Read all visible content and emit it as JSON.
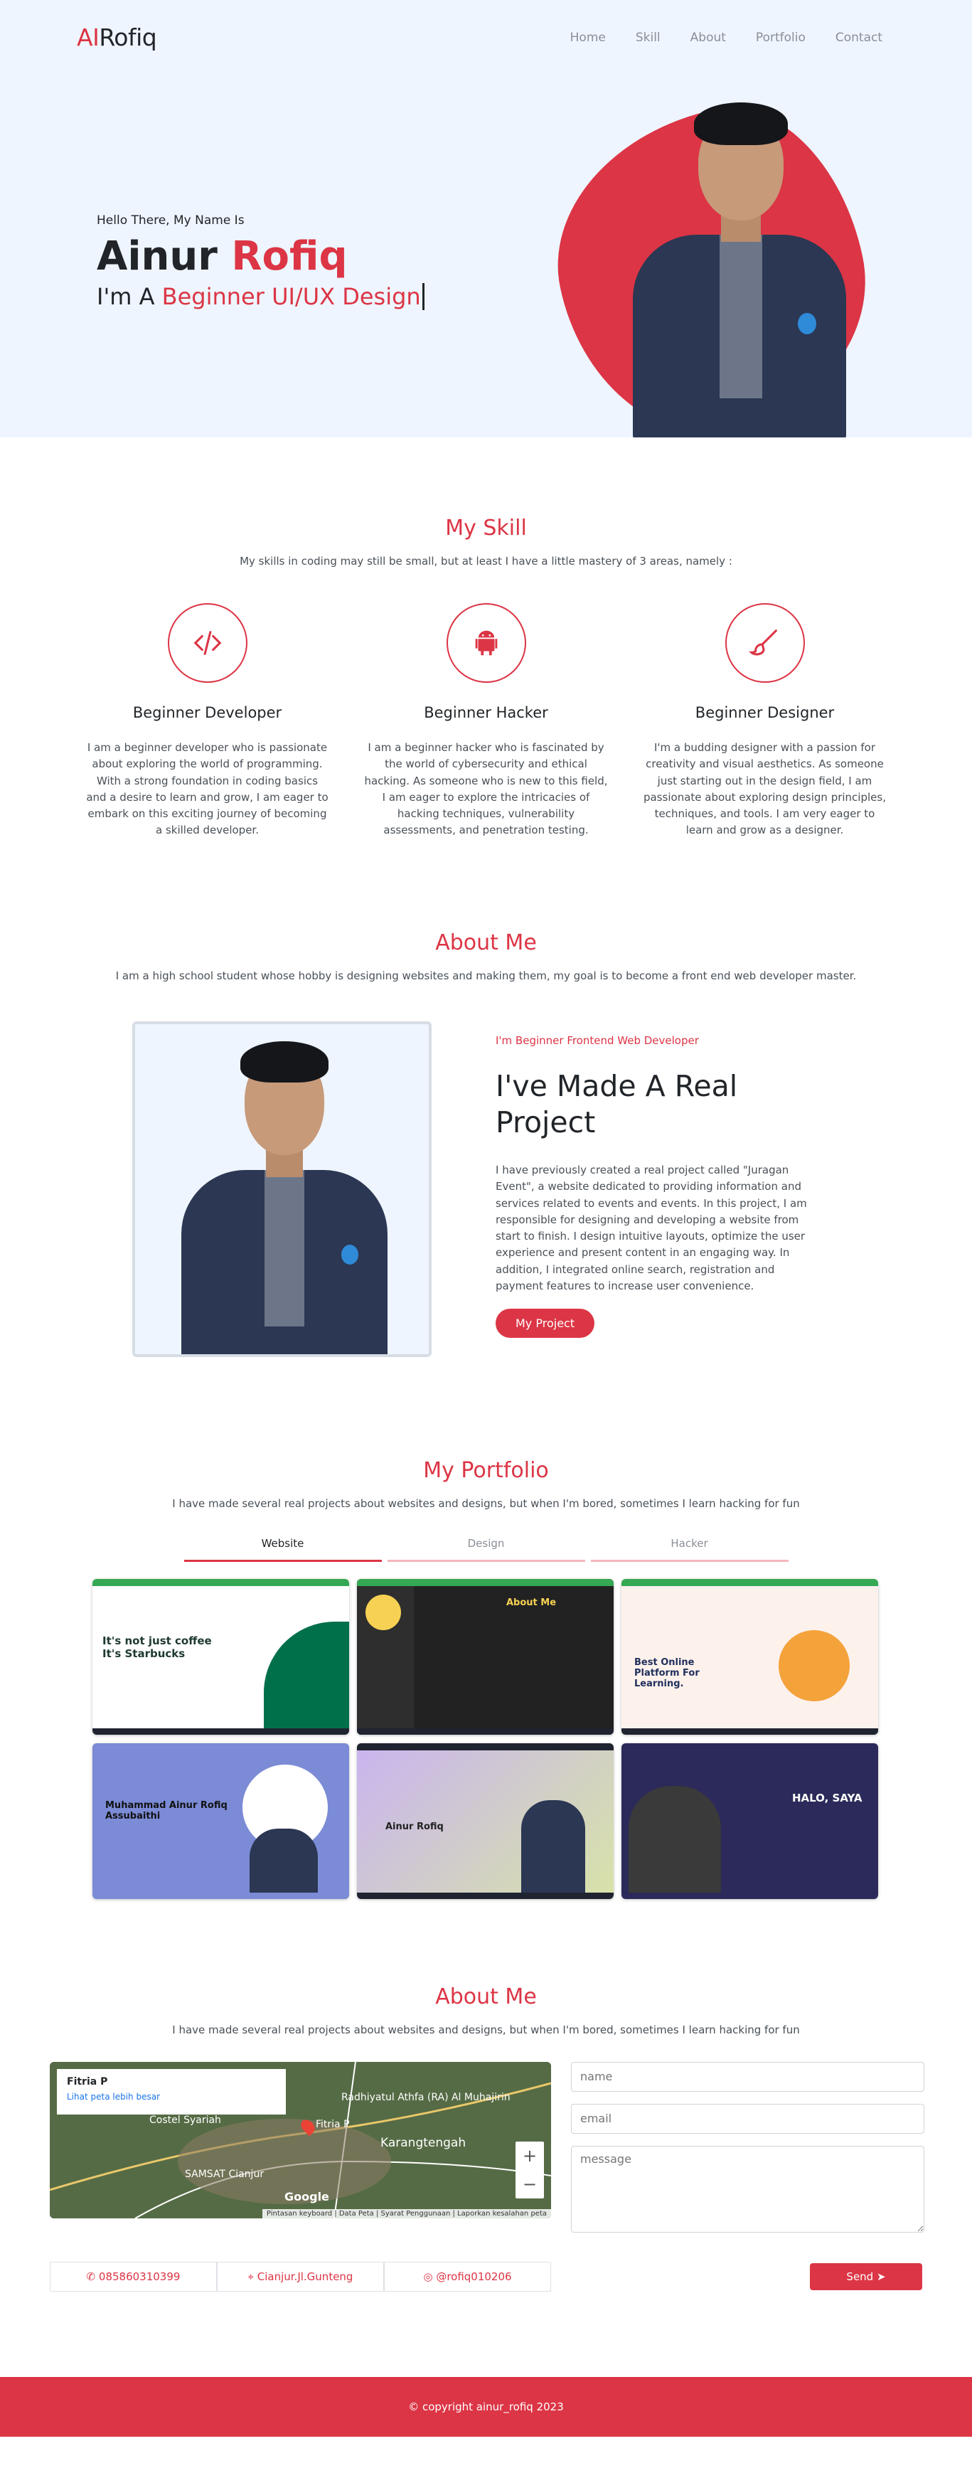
{
  "nav": {
    "brand_accent": "AI",
    "brand_rest": "Rofiq",
    "links": [
      "Home",
      "Skill",
      "About",
      "Portfolio",
      "Contact"
    ]
  },
  "hero": {
    "hello": "Hello There, My Name Is",
    "first_name": "Ainur",
    "last_name": "Rofiq",
    "role_prefix": "I'm A",
    "role": "Beginner UI/UX Design"
  },
  "skills": {
    "title": "My Skill",
    "subtitle": "My skills in coding may still be small, but at least I have a little mastery of 3 areas, namely :",
    "items": [
      {
        "icon": "code-icon",
        "title": "Beginner Developer",
        "text": "I am a beginner developer who is passionate about exploring the world of programming. With a strong foundation in coding basics and a desire to learn and grow, I am eager to embark on this exciting journey of becoming a skilled developer."
      },
      {
        "icon": "android-icon",
        "title": "Beginner Hacker",
        "text": "I am a beginner hacker who is fascinated by the world of cybersecurity and ethical hacking. As someone who is new to this field, I am eager to explore the intricacies of hacking techniques, vulnerability assessments, and penetration testing."
      },
      {
        "icon": "brush-icon",
        "title": "Beginner Designer",
        "text": "I'm a budding designer with a passion for creativity and visual aesthetics. As someone just starting out in the design field, I am passionate about exploring design principles, techniques, and tools. I am very eager to learn and grow as a designer."
      }
    ]
  },
  "about": {
    "title": "About Me",
    "subtitle": "I am a high school student whose hobby is designing websites and making them, my goal is to become a front end web developer master.",
    "kicker": "I'm Beginner Frontend Web Developer",
    "heading": "I've Made A Real Project",
    "body": "I have previously created a real project called \"Juragan Event\", a website dedicated to providing information and services related to events and events. In this project, I am responsible for designing and developing a website from start to finish. I design intuitive layouts, optimize the user experience and present content in an engaging way. In addition, I integrated online search, registration and payment features to increase user convenience.",
    "button": "My Project"
  },
  "portfolio": {
    "title": "My Portfolio",
    "subtitle": "I have made several real projects about websites and designs, but when I'm bored, sometimes I learn hacking for fun",
    "tabs": [
      "Website",
      "Design",
      "Hacker"
    ],
    "active_tab": "Website",
    "cards": [
      {
        "label": "It's not just coffee It's Starbucks",
        "bg": "#ffffff",
        "fg": "#1e3932"
      },
      {
        "label": "About Me",
        "bg": "#222222",
        "fg": "#f7d154"
      },
      {
        "label": "Best Online Platform For Learning.",
        "bg": "#fdf1ec",
        "fg": "#1f2f5c"
      },
      {
        "label": "Muhammad Ainur Rofiq Assubaithi",
        "bg": "#7b8bd6",
        "fg": "#111111"
      },
      {
        "label": "Ainur Rofiq",
        "bg": "#b8aee8",
        "fg": "#222222"
      },
      {
        "label": "HALO, SAYA",
        "bg": "#2b2a5a",
        "fg": "#ffffff"
      }
    ]
  },
  "contact": {
    "title": "About Me",
    "subtitle": "I have made several real projects about websites and designs, but when I'm bored, sometimes I learn hacking for fun",
    "map": {
      "place": "Fitria P",
      "link": "Lihat peta lebih besar",
      "labels": [
        "Radhiyatul Athfa (RA) Al Muhajirin",
        "Costel Syariah",
        "Fitria P",
        "Karangtengah",
        "SAMSAT Cianjur",
        "Google"
      ],
      "footer": "Pintasan keyboard | Data Peta | Syarat Penggunaan | Laporkan kesalahan peta"
    },
    "phone": "085860310399",
    "location": "Cianjur.Jl.Gunteng",
    "instagram": "@rofiq010206",
    "placeholders": {
      "name": "name",
      "email": "email",
      "message": "message"
    },
    "send": "Send"
  },
  "footer": {
    "text": "© copyright ainur_rofiq 2023"
  },
  "colors": {
    "accent": "#dc3545",
    "hero_bg": "#eef5fe"
  }
}
